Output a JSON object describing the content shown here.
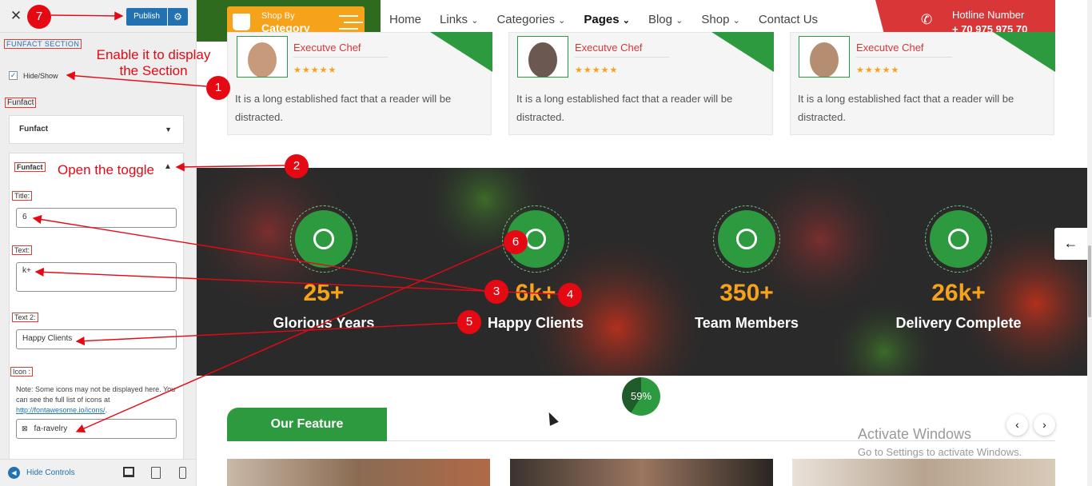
{
  "customizer": {
    "close": "✕",
    "publish": "Publish",
    "section_label": "FUNFACT SECTION",
    "hide_show_label": "Hide/Show",
    "funfact_heading": "Funfact",
    "dropdown_value": "Funfact",
    "toggle_label": "Funfact",
    "title_label": "Title:",
    "title_value": "6",
    "text_label": "Text:",
    "text_value": "k+",
    "text2_label": "Text 2:",
    "text2_value": "Happy Clients",
    "icon_label": "Icon :",
    "icon_note": "Note: Some icons may not be displayed here. You can see the full list of icons at",
    "icon_link": "http://fontawesome.io/icons/",
    "icon_note_end": ".",
    "icon_value": "fa-ravelry",
    "hide_controls": "Hide Controls"
  },
  "annotations": {
    "enable_note": "Enable it to display the Section",
    "toggle_note": "Open the toggle",
    "markers": [
      "1",
      "2",
      "3",
      "4",
      "5",
      "6",
      "7"
    ]
  },
  "header": {
    "shop_by": "Shop By",
    "category": "Category",
    "nav": [
      "Home",
      "Links",
      "Categories",
      "Pages",
      "Blog",
      "Shop",
      "Contact Us"
    ],
    "hotline_title": "Hotline Number",
    "hotline_number": "+ 70 975 975 70"
  },
  "testimonials": [
    {
      "role": "Executve Chef",
      "stars": "★★★★★",
      "text": "It is a long established fact that a reader will be distracted."
    },
    {
      "role": "Executve Chef",
      "stars": "★★★★★",
      "text": "It is a long established fact that a reader will be distracted."
    },
    {
      "role": "Executve Chef",
      "stars": "★★★★★",
      "text": "It is a long established fact that a reader will be distracted."
    }
  ],
  "funfacts": [
    {
      "number": "25+",
      "label": "Glorious Years"
    },
    {
      "number": "6k+",
      "label": "Happy Clients"
    },
    {
      "number": "350+",
      "label": "Team Members"
    },
    {
      "number": "26k+",
      "label": "Delivery Complete"
    }
  ],
  "progress_badge": "59%",
  "progress_value": 0.59,
  "feature_tab": "Our Feature",
  "watermark": {
    "title": "Activate Windows",
    "subtitle": "Go to Settings to activate Windows."
  },
  "colors": {
    "accent_green": "#2e9a3f",
    "orange": "#f7a21b",
    "red": "#d83637",
    "wp_blue": "#2271b1"
  }
}
